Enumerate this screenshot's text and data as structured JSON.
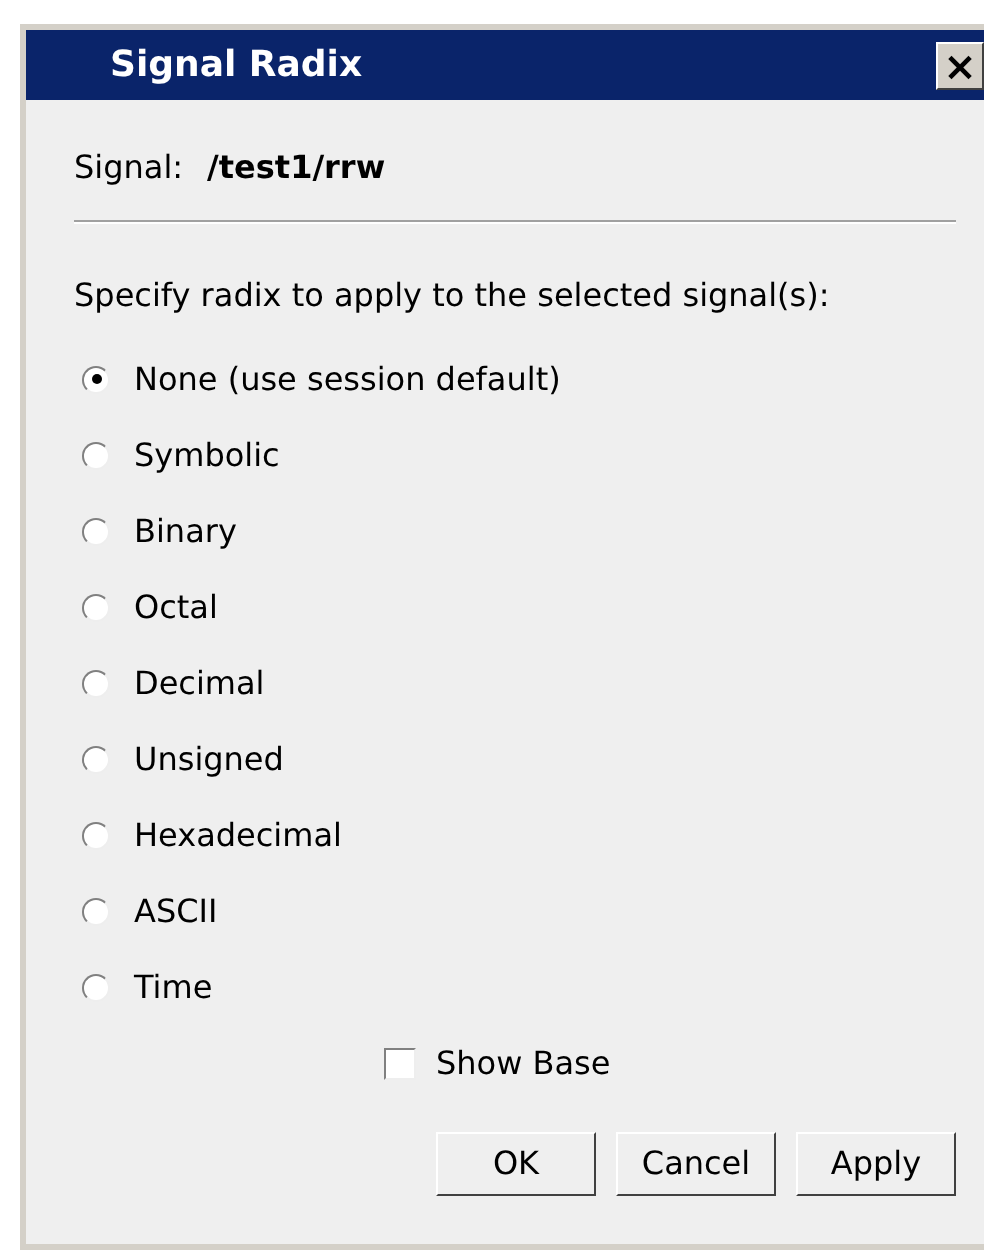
{
  "window": {
    "title": "Signal Radix",
    "close": "×"
  },
  "signal": {
    "label": "Signal:",
    "value": "/test1/rrw"
  },
  "prompt": "Specify radix to apply to the selected signal(s):",
  "radix_options": [
    {
      "label": "None (use session default)",
      "selected": true
    },
    {
      "label": "Symbolic",
      "selected": false
    },
    {
      "label": "Binary",
      "selected": false
    },
    {
      "label": "Octal",
      "selected": false
    },
    {
      "label": "Decimal",
      "selected": false
    },
    {
      "label": "Unsigned",
      "selected": false
    },
    {
      "label": "Hexadecimal",
      "selected": false
    },
    {
      "label": "ASCII",
      "selected": false
    },
    {
      "label": "Time",
      "selected": false
    }
  ],
  "show_base": {
    "label": "Show Base",
    "checked": false
  },
  "buttons": [
    "OK",
    "Cancel",
    "Apply"
  ]
}
